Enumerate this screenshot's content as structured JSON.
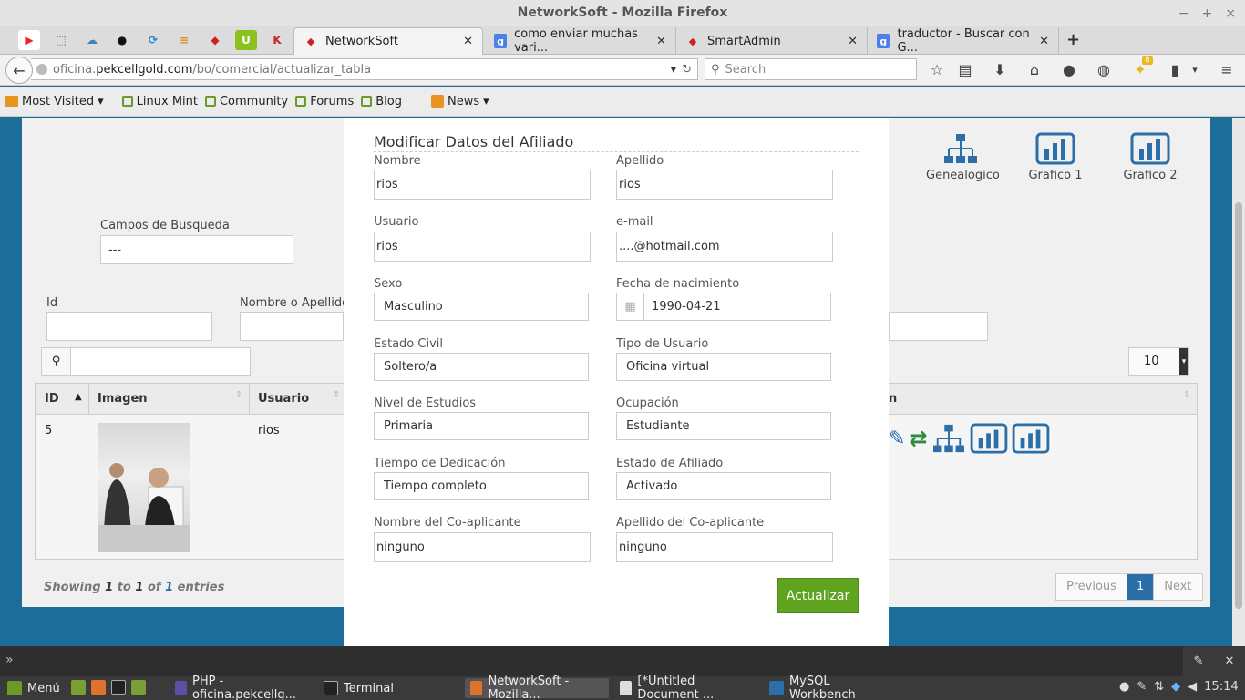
{
  "window": {
    "title": "NetworkSoft - Mozilla Firefox"
  },
  "tabs": [
    {
      "label": "NetworkSoft",
      "active": true
    },
    {
      "label": "como enviar muchas vari...",
      "active": false
    },
    {
      "label": "SmartAdmin",
      "active": false
    },
    {
      "label": "traductor - Buscar con G...",
      "active": false
    }
  ],
  "nav": {
    "url_prefix": "oficina.",
    "url_domain": "pekcellgold.com",
    "url_path": "/bo/comercial/actualizar_tabla",
    "search_placeholder": "Search",
    "badge_count": "8"
  },
  "bookmarks": [
    "Most Visited",
    "Linux Mint",
    "Community",
    "Forums",
    "Blog",
    "News"
  ],
  "background": {
    "campos_label": "Campos de Busqueda",
    "campos_value": "---",
    "id_label": "Id",
    "nombre_label": "Nombre o Apellido",
    "page_size": "10",
    "icons": [
      {
        "label": "Genealogico",
        "icon": "sitemap-icon"
      },
      {
        "label": "Grafico 1",
        "icon": "bar-chart-icon"
      },
      {
        "label": "Grafico 2",
        "icon": "bar-chart-icon"
      }
    ],
    "columns": [
      "ID",
      "Imagen",
      "Usuario",
      "n"
    ],
    "row": {
      "id": "5",
      "usuario": "rios"
    },
    "footer": {
      "showing": "Showing",
      "from": "1",
      "to_word": "to",
      "to": "1",
      "of_word": "of",
      "total": "1",
      "entries": "entries"
    },
    "pagination": {
      "previous": "Previous",
      "current": "1",
      "next": "Next"
    }
  },
  "modal": {
    "title": "Modificar Datos del Afiliado",
    "fields": {
      "nombre": {
        "label": "Nombre",
        "value": "rios"
      },
      "apellido": {
        "label": "Apellido",
        "value": "rios"
      },
      "usuario": {
        "label": "Usuario",
        "value": "rios"
      },
      "email": {
        "label": "e-mail",
        "value": "....@hotmail.com"
      },
      "sexo": {
        "label": "Sexo",
        "value": "Masculino"
      },
      "fecha": {
        "label": "Fecha de nacimiento",
        "value": "1990-04-21"
      },
      "estado_civil": {
        "label": "Estado Civil",
        "value": "Soltero/a"
      },
      "tipo_usuario": {
        "label": "Tipo de Usuario",
        "value": "Oficina virtual"
      },
      "nivel_estudios": {
        "label": "Nivel de Estudios",
        "value": "Primaria"
      },
      "ocupacion": {
        "label": "Ocupación",
        "value": "Estudiante"
      },
      "tiempo": {
        "label": "Tiempo de Dedicación",
        "value": "Tiempo completo"
      },
      "estado_afiliado": {
        "label": "Estado de Afiliado",
        "value": "Activado"
      },
      "nombre_co": {
        "label": "Nombre del Co-aplicante",
        "value": "ninguno"
      },
      "apellido_co": {
        "label": "Apellido del Co-aplicante",
        "value": "ninguno"
      }
    },
    "submit": "Actualizar"
  },
  "taskbar": {
    "menu": "Menú",
    "tasks": [
      {
        "label": "PHP - oficina.pekcellg..."
      },
      {
        "label": "Terminal"
      },
      {
        "label": "NetworkSoft - Mozilla..."
      },
      {
        "label": "[*Untitled Document ..."
      },
      {
        "label": "MySQL Workbench"
      }
    ],
    "clock": "15:14"
  },
  "colors": {
    "accent_green": "#5fa31e",
    "page_blue": "#1d6d9a",
    "icon_blue": "#2b6ea8"
  }
}
